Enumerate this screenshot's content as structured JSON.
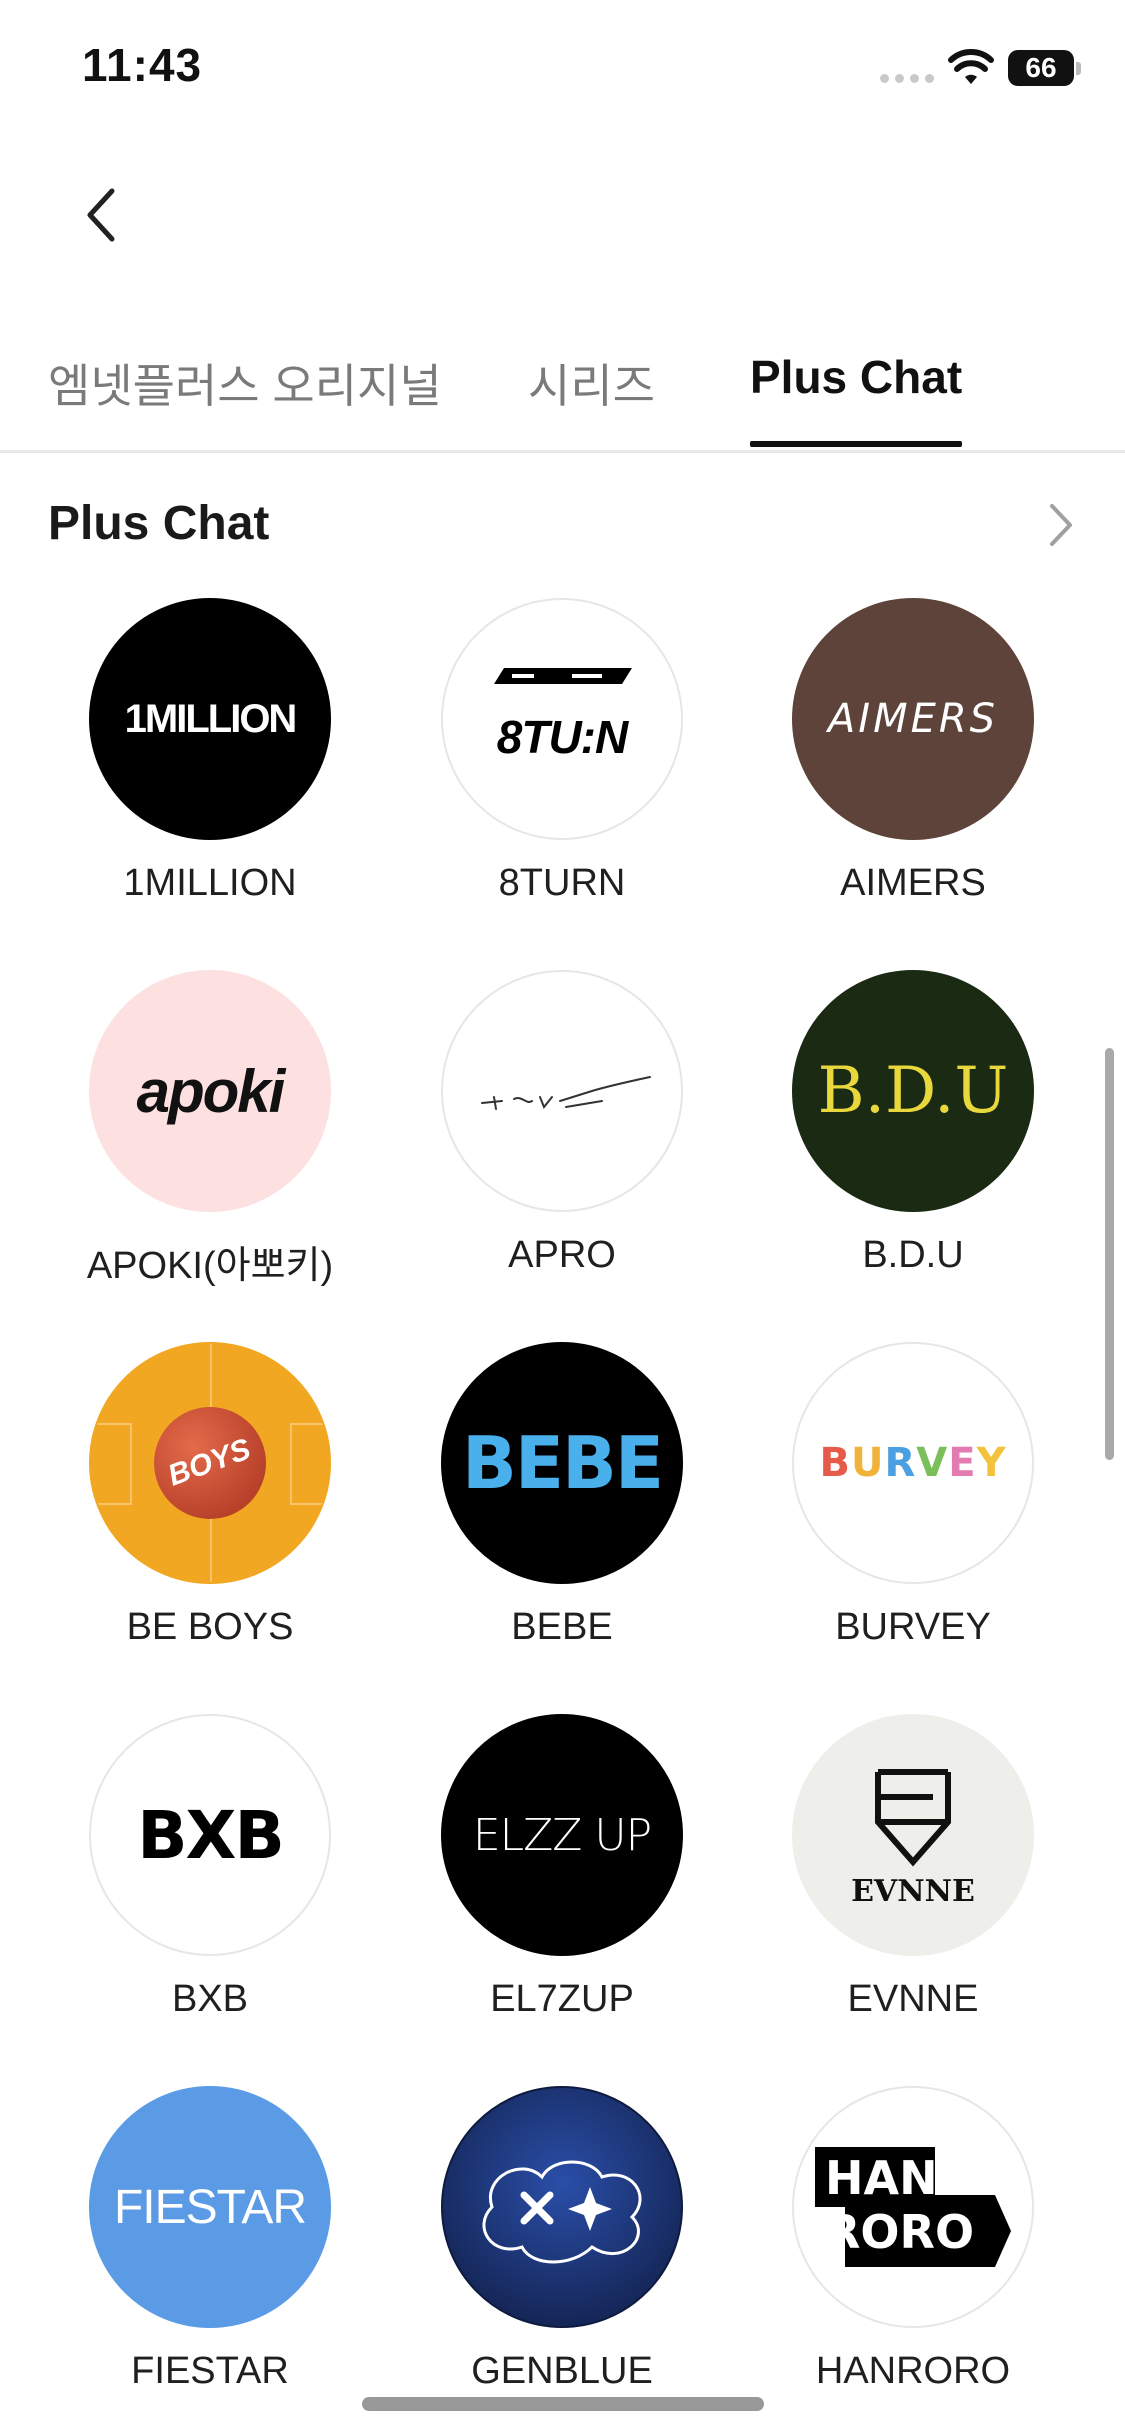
{
  "status_bar": {
    "time": "11:43",
    "battery": "66"
  },
  "tabs": [
    {
      "label": "엠넷플러스 오리지널",
      "active": false
    },
    {
      "label": "시리즈",
      "active": false
    },
    {
      "label": "Plus Chat",
      "active": true
    }
  ],
  "section": {
    "title": "Plus Chat"
  },
  "artists": [
    {
      "name": "1MILLION",
      "logo_text": "1MILLION",
      "bg": "#000000",
      "fg": "#ffffff"
    },
    {
      "name": "8TURN",
      "logo_text": "8TU:N",
      "bg": "#ffffff",
      "fg": "#000000"
    },
    {
      "name": "AIMERS",
      "logo_text": "AIMERS",
      "bg": "#5e433a",
      "fg": "#ffffff"
    },
    {
      "name": "APOKI(아뽀키)",
      "logo_text": "apoki",
      "bg": "#fde0e0",
      "fg": "#111111"
    },
    {
      "name": "APRO",
      "logo_text": "",
      "bg": "#ffffff",
      "fg": "#222222"
    },
    {
      "name": "B.D.U",
      "logo_text": "B.D.U",
      "bg": "#1b2a12",
      "fg": "#e9d83c"
    },
    {
      "name": "BE BOYS",
      "logo_text": "BOYS",
      "bg": "#f2a722",
      "fg": "#ffffff"
    },
    {
      "name": "BEBE",
      "logo_text": "BEBE",
      "bg": "#000000",
      "fg": "#4ab0ec"
    },
    {
      "name": "BURVEY",
      "logo_text": "BURVEY",
      "bg": "#ffffff",
      "fg": "#e65a4a"
    },
    {
      "name": "BXB",
      "logo_text": "BXB",
      "bg": "#ffffff",
      "fg": "#000000"
    },
    {
      "name": "EL7ZUP",
      "logo_text": "ELZZ UP",
      "bg": "#000000",
      "fg": "#ffffff"
    },
    {
      "name": "EVNNE",
      "logo_text": "EVNNE",
      "bg": "#eeeeea",
      "fg": "#111111"
    },
    {
      "name": "FIESTAR",
      "logo_text": "FIESTAR",
      "bg": "#5b9be6",
      "fg": "#ffffff"
    },
    {
      "name": "GENBLUE",
      "logo_text": "",
      "bg": "#0e1a3e",
      "fg": "#ffffff"
    },
    {
      "name": "HANRORO",
      "logo_text": "HAN RORO",
      "bg": "#ffffff",
      "fg": "#ffffff"
    }
  ],
  "icons": {
    "back": "chevron-left-icon",
    "more": "chevron-right-icon"
  }
}
